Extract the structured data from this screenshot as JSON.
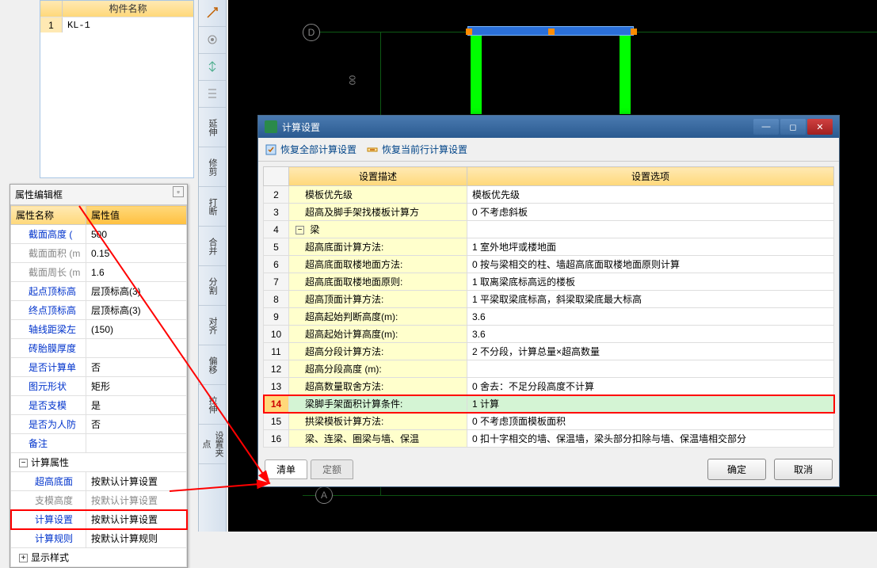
{
  "component_panel": {
    "header": "构件名称",
    "rows": [
      {
        "num": "1",
        "name": "KL-1"
      }
    ]
  },
  "prop_panel": {
    "title": "属性编辑框",
    "headers": {
      "name": "属性名称",
      "value": "属性值"
    },
    "rows": [
      {
        "name": "截面高度 (",
        "val": "500",
        "cls": ""
      },
      {
        "name": "截面面积 (m",
        "val": "0.15",
        "cls": "gray"
      },
      {
        "name": "截面周长 (m",
        "val": "1.6",
        "cls": "gray"
      },
      {
        "name": "起点顶标高",
        "val": "层顶标高(3)",
        "cls": ""
      },
      {
        "name": "终点顶标高",
        "val": "层顶标高(3)",
        "cls": ""
      },
      {
        "name": "轴线距梁左",
        "val": "(150)",
        "cls": ""
      },
      {
        "name": "砖胎膜厚度",
        "val": "",
        "cls": ""
      },
      {
        "name": "是否计算单",
        "val": "否",
        "cls": ""
      },
      {
        "name": "图元形状",
        "val": "矩形",
        "cls": ""
      },
      {
        "name": "是否支模",
        "val": "是",
        "cls": ""
      },
      {
        "name": "是否为人防",
        "val": "否",
        "cls": ""
      },
      {
        "name": "备注",
        "val": "",
        "cls": ""
      }
    ],
    "calc_group": "计算属性",
    "calc_rows": [
      {
        "name": "超高底面",
        "val": "按默认计算设置",
        "cls": ""
      },
      {
        "name": "支模高度",
        "val": "按默认计算设置",
        "cls": "gray"
      },
      {
        "name": "计算设置",
        "val": "按默认计算设置",
        "cls": "",
        "highlight": true
      },
      {
        "name": "计算规则",
        "val": "按默认计算规则",
        "cls": ""
      }
    ],
    "display_group": "显示样式"
  },
  "vtoolbar": {
    "items": [
      "延伸",
      "修剪",
      "打断",
      "合并",
      "分割",
      "对齐",
      "偏移",
      "拉伸",
      "设置夹点"
    ]
  },
  "dialog": {
    "title": "计算设置",
    "toolbar": {
      "restore_all": "恢复全部计算设置",
      "restore_row": "恢复当前行计算设置"
    },
    "headers": {
      "desc": "设置描述",
      "option": "设置选项"
    },
    "rows": [
      {
        "n": "2",
        "desc": "模板优先级",
        "opt": "模板优先级",
        "indent": 1
      },
      {
        "n": "3",
        "desc": "超高及脚手架找楼板计算方",
        "opt": "0 不考虑斜板",
        "indent": 1
      },
      {
        "n": "4",
        "desc": "梁",
        "opt": "",
        "indent": 0,
        "group": true
      },
      {
        "n": "5",
        "desc": "超高底面计算方法:",
        "opt": "1 室外地坪或楼地面",
        "indent": 1
      },
      {
        "n": "6",
        "desc": "超高底面取楼地面方法:",
        "opt": "0 按与梁相交的柱、墙超高底面取楼地面原则计算",
        "indent": 1
      },
      {
        "n": "7",
        "desc": "超高底面取楼地面原则:",
        "opt": "1 取离梁底标高远的楼板",
        "indent": 1
      },
      {
        "n": "8",
        "desc": "超高顶面计算方法:",
        "opt": "1 平梁取梁底标高，斜梁取梁底最大标高",
        "indent": 1
      },
      {
        "n": "9",
        "desc": "超高起始判断高度(m):",
        "opt": "3.6",
        "indent": 1
      },
      {
        "n": "10",
        "desc": "超高起始计算高度(m):",
        "opt": "3.6",
        "indent": 1
      },
      {
        "n": "11",
        "desc": "超高分段计算方法:",
        "opt": "2 不分段，计算总量×超高数量",
        "indent": 1
      },
      {
        "n": "12",
        "desc": "超高分段高度 (m):",
        "opt": "",
        "indent": 1
      },
      {
        "n": "13",
        "desc": "超高数量取舍方法:",
        "opt": "0 舍去：不足分段高度不计算",
        "indent": 1
      },
      {
        "n": "14",
        "desc": "梁脚手架面积计算条件:",
        "opt": "1 计算",
        "indent": 1,
        "sel": true,
        "highlight": true
      },
      {
        "n": "15",
        "desc": "拱梁模板计算方法:",
        "opt": "0 不考虑顶面模板面积",
        "indent": 1
      },
      {
        "n": "16",
        "desc": "梁、连梁、圈梁与墙、保温",
        "opt": "0 扣十字相交的墙、保温墙，梁头部分扣除与墙、保温墙相交部分",
        "indent": 1
      }
    ],
    "footer_tabs": {
      "list": "清单",
      "quota": "定额"
    },
    "buttons": {
      "ok": "确定",
      "cancel": "取消"
    }
  },
  "canvas": {
    "axis_d": "D",
    "axis_a": "A",
    "dim_text": "00"
  }
}
